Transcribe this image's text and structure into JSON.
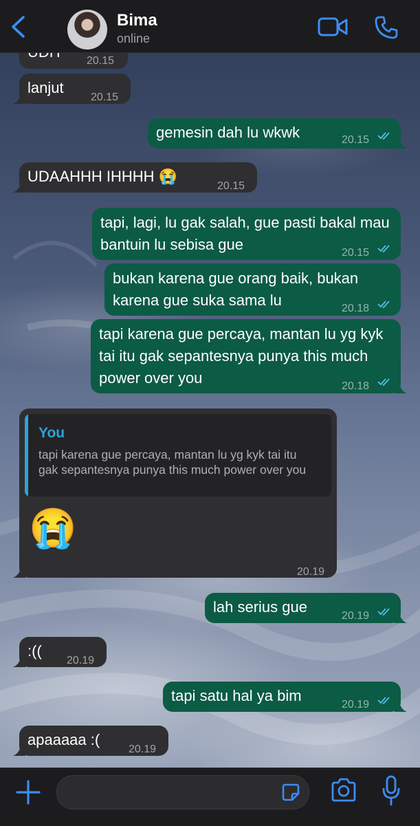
{
  "header": {
    "back_icon": "chevron-left-icon",
    "name": "Bima",
    "status": "online",
    "video_icon": "video-call-icon",
    "phone_icon": "phone-icon",
    "accent": "#3d8cf5"
  },
  "messages": [
    {
      "dir": "in",
      "text": "UDH",
      "time": "20.15"
    },
    {
      "dir": "in",
      "text": "lanjut",
      "time": "20.15"
    },
    {
      "dir": "out",
      "text": "gemesin dah lu wkwk",
      "time": "20.15",
      "read": true
    },
    {
      "dir": "in",
      "text": "UDAAHHH IHHHH 😭",
      "time": "20.15"
    },
    {
      "dir": "out",
      "text": "tapi, lagi, lu gak salah, gue pasti bakal mau bantuin lu sebisa gue",
      "time": "20.15",
      "read": true
    },
    {
      "dir": "out",
      "text": "bukan karena gue orang baik, bukan karena gue suka sama lu",
      "time": "20.18",
      "read": true
    },
    {
      "dir": "out",
      "text": "tapi karena gue percaya, mantan lu yg kyk tai itu gak sepantesnya punya this much power over you",
      "time": "20.18",
      "read": true
    },
    {
      "dir": "in",
      "reply_to": {
        "author": "You",
        "text": "tapi karena gue percaya, mantan lu yg kyk tai itu gak sepantesnya punya this much power over you"
      },
      "text": "😭",
      "time": "20.19"
    },
    {
      "dir": "out",
      "text": "lah serius gue",
      "time": "20.19",
      "read": true
    },
    {
      "dir": "in",
      "text": ":((",
      "time": "20.19"
    },
    {
      "dir": "out",
      "text": "tapi satu hal ya bim",
      "time": "20.19",
      "read": true
    },
    {
      "dir": "in",
      "text": "apaaaaa :(",
      "time": "20.19"
    }
  ],
  "composer": {
    "plus_icon": "plus-icon",
    "placeholder": "",
    "sticker_icon": "sticker-icon",
    "camera_icon": "camera-icon",
    "mic_icon": "microphone-icon"
  },
  "colors": {
    "incoming_bubble": "#2f2f31",
    "outgoing_bubble": "#0c5b45",
    "read_ticks": "#53bdeb",
    "quote_accent": "#2fa3d8"
  }
}
